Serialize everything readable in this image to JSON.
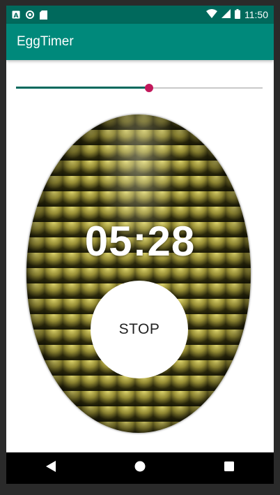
{
  "status_bar": {
    "time": "11:50",
    "left_icons": [
      "a-notification-icon",
      "circle-notification-icon",
      "sd-card-icon"
    ],
    "right_icons": [
      "wifi-icon",
      "signal-icon",
      "battery-icon"
    ]
  },
  "app_bar": {
    "title": "EggTimer"
  },
  "timer": {
    "slider_value_fraction": 0.54,
    "time_remaining": "05:28",
    "stop_label": "STOP"
  },
  "nav_bar": {
    "icons": [
      "back-icon",
      "home-icon",
      "recents-icon"
    ]
  },
  "colors": {
    "status_bar": "#00695c",
    "app_bar": "#00897b",
    "slider_active": "#00695c",
    "slider_thumb": "#c2185b",
    "egg_shell": "#4a4418"
  }
}
